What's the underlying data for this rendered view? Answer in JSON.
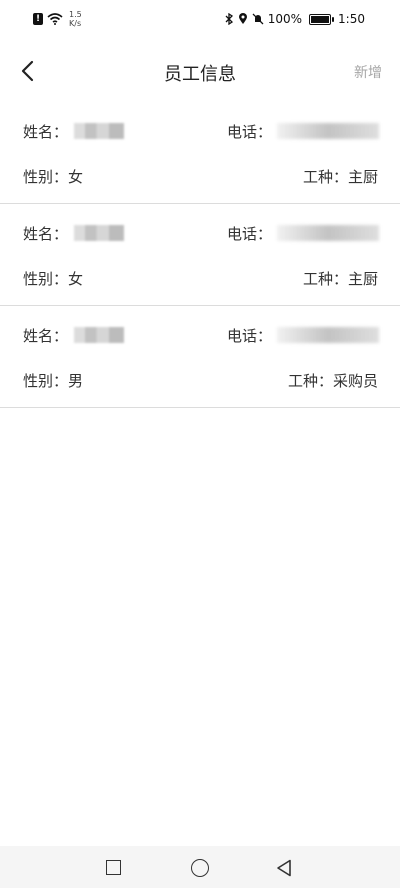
{
  "status_bar": {
    "speed_value": "1.5",
    "speed_unit": "K/s",
    "battery": "100%",
    "time": "1:50"
  },
  "header": {
    "title": "员工信息",
    "add_label": "新增"
  },
  "labels": {
    "name": "姓名：",
    "phone": "电话：",
    "gender_prefix": "性别：",
    "job_prefix": "工种："
  },
  "employees": [
    {
      "gender": "性别：女",
      "job": "工种：主厨"
    },
    {
      "gender": "性别：女",
      "job": "工种：主厨"
    },
    {
      "gender": "性别：男",
      "job": "工种：采购员"
    }
  ]
}
